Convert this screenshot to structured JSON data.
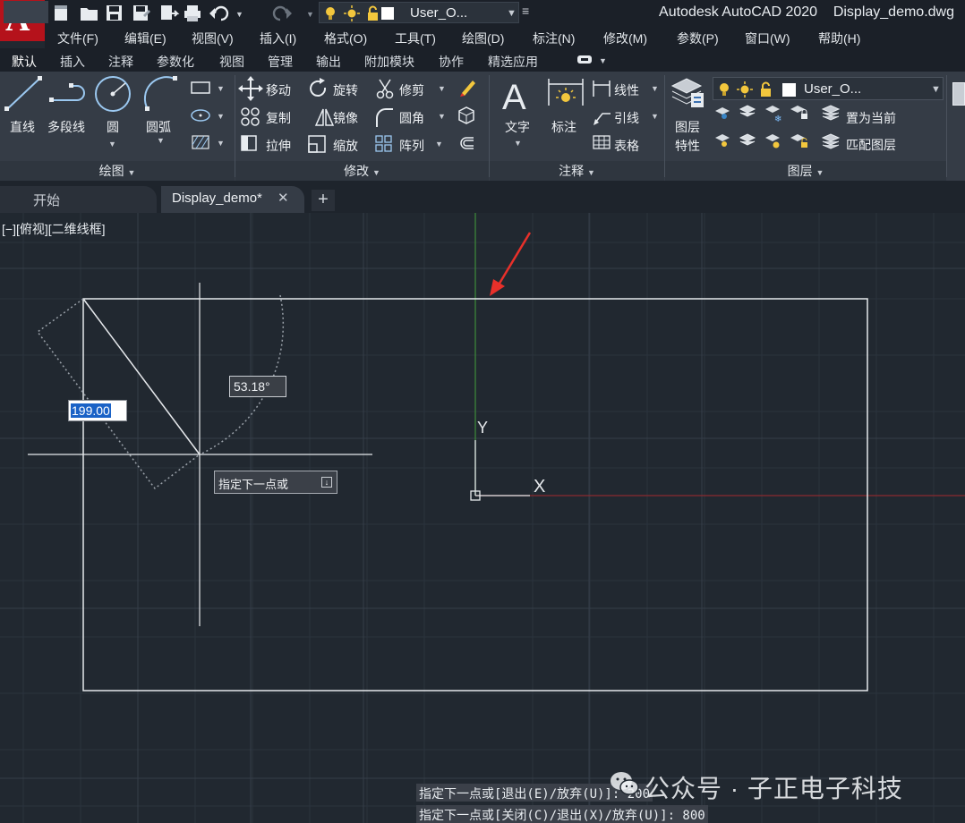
{
  "app": {
    "logo_letter": "A",
    "title": "Autodesk AutoCAD 2020    Display_demo.dwg"
  },
  "quick_access": {
    "layer_name": "User_O...",
    "icons": [
      "new-icon",
      "open-icon",
      "save-icon",
      "saveas-icon",
      "publish-icon",
      "plot-icon",
      "undo-icon",
      "redo-icon"
    ]
  },
  "menu": [
    "文件(F)",
    "编辑(E)",
    "视图(V)",
    "插入(I)",
    "格式(O)",
    "工具(T)",
    "绘图(D)",
    "标注(N)",
    "修改(M)",
    "参数(P)",
    "窗口(W)",
    "帮助(H)"
  ],
  "ribbon_tabs": [
    "默认",
    "插入",
    "注释",
    "参数化",
    "视图",
    "管理",
    "输出",
    "附加模块",
    "协作",
    "精选应用"
  ],
  "draw_panel": {
    "title": "绘图",
    "line": "直线",
    "polyline": "多段线",
    "circle": "圆",
    "arc": "圆弧"
  },
  "modify_panel": {
    "title": "修改",
    "move": "移动",
    "rotate": "旋转",
    "trim": "修剪",
    "copy": "复制",
    "mirror": "镜像",
    "fillet": "圆角",
    "stretch": "拉伸",
    "scale": "缩放",
    "array": "阵列"
  },
  "annotation_panel": {
    "title": "注释",
    "text": "文字",
    "dimension": "标注",
    "linear": "线性",
    "leader": "引线",
    "table": "表格"
  },
  "layers_panel": {
    "title": "图层",
    "properties_line1": "图层",
    "properties_line2": "特性",
    "current_layer": "User_O...",
    "set_current": "置为当前",
    "match_layer": "匹配图层"
  },
  "doc_tabs": {
    "start": "开始",
    "active": "Display_demo*",
    "close": "✕",
    "add": "+"
  },
  "viewport": {
    "label": "[−][俯视][二维线框]"
  },
  "dynamic_input": {
    "length": "199.00",
    "angle": "53.18°",
    "prompt": "指定下一点或"
  },
  "ucs": {
    "x_label": "X",
    "y_label": "Y"
  },
  "command_history": [
    "指定下一点或[退出(E)/放弃(U)]: 200",
    "指定下一点或[关闭(C)/退出(X)/放弃(U)]: 800"
  ],
  "watermark": "公众号 · 子正电子科技",
  "colors": {
    "accent_red": "#e8302a",
    "canvas_bg": "#212830",
    "ribbon_bg": "#353c46"
  }
}
